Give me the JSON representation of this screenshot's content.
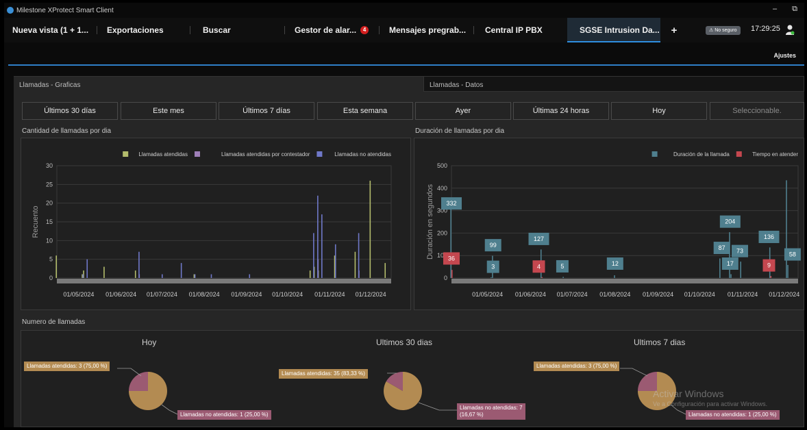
{
  "window": {
    "title": "Milestone XProtect Smart Client",
    "minimize_glyph": "–",
    "restore_glyph": "⧉"
  },
  "tabs": [
    {
      "label": "Nueva vista (1 + 1...",
      "badge": ""
    },
    {
      "label": "Exportaciones",
      "badge": ""
    },
    {
      "label": "Buscar",
      "badge": ""
    },
    {
      "label": "Gestor de alar...",
      "badge": "4"
    },
    {
      "label": "Mensajes pregrab...",
      "badge": ""
    },
    {
      "label": "Central IP PBX",
      "badge": ""
    },
    {
      "label": "SGSE Intrusion Da...",
      "badge": ""
    }
  ],
  "add_tab": "+",
  "status": {
    "security": "⚠ No seguro",
    "time": "17:29:25"
  },
  "settings_label": "Ajustes",
  "subtabs": {
    "graphs": "Llamadas - Graficas",
    "data": "Llamadas - Datos"
  },
  "filters": [
    "Últimos 30 días",
    "Este mes",
    "Últimos 7 días",
    "Esta semana",
    "Ayer",
    "Últimas 24 horas",
    "Hoy",
    "Seleccionable."
  ],
  "sections": {
    "count": "Cantidad de llamadas por dia",
    "duration": "Duración de llamadas por dia",
    "number": "Numero de llamadas"
  },
  "colors": {
    "answered": "#b3bc6c",
    "voicemail": "#9e7fb8",
    "unanswered": "#6f78c8",
    "duration": "#4f7f8e",
    "wait": "#c4474f",
    "pie_answered": "#b38b52",
    "pie_unanswered": "#9b5a72",
    "accent": "#2f8ee0"
  },
  "chart_data": [
    {
      "type": "bar",
      "title": "Cantidad de llamadas por dia",
      "ylabel": "Recuento",
      "ylim": [
        0,
        30
      ],
      "yticks": [
        0,
        5,
        10,
        15,
        20,
        25,
        30
      ],
      "xlim": [
        "2024-04-15",
        "2024-12-16"
      ],
      "xticks": [
        "01/05/2024",
        "01/06/2024",
        "01/07/2024",
        "01/08/2024",
        "01/09/2024",
        "01/10/2024",
        "01/11/2024",
        "01/12/2024"
      ],
      "legend_position": "top-right",
      "grid": true,
      "series": [
        {
          "name": "Llamadas atendidas",
          "points": [
            [
              "2024-04-15",
              6
            ],
            [
              "2024-05-04",
              1
            ],
            [
              "2024-05-05",
              2
            ],
            [
              "2024-05-20",
              3
            ],
            [
              "2024-06-12",
              2
            ],
            [
              "2024-07-25",
              1
            ],
            [
              "2024-10-18",
              2
            ],
            [
              "2024-10-21",
              3
            ],
            [
              "2024-10-24",
              2
            ],
            [
              "2024-11-05",
              6
            ],
            [
              "2024-11-20",
              7
            ],
            [
              "2024-12-01",
              26
            ],
            [
              "2024-12-12",
              4
            ]
          ]
        },
        {
          "name": "Llamadas atendidas por contestador",
          "points": [
            [
              "2024-06-14",
              1
            ],
            [
              "2024-10-23",
              5
            ],
            [
              "2024-11-22",
              2
            ]
          ]
        },
        {
          "name": "Llamadas no atendidas",
          "points": [
            [
              "2024-05-03",
              1
            ],
            [
              "2024-05-06",
              5
            ],
            [
              "2024-06-13",
              7
            ],
            [
              "2024-06-30",
              1
            ],
            [
              "2024-07-14",
              4
            ],
            [
              "2024-07-24",
              1
            ],
            [
              "2024-08-05",
              1
            ],
            [
              "2024-09-02",
              1
            ],
            [
              "2024-10-19",
              12
            ],
            [
              "2024-10-22",
              22
            ],
            [
              "2024-10-25",
              17
            ],
            [
              "2024-11-04",
              9
            ],
            [
              "2024-11-21",
              12
            ]
          ]
        }
      ]
    },
    {
      "type": "bar",
      "title": "Duración de llamadas por dia",
      "ylabel": "Duración en segundos",
      "ylim": [
        0,
        500
      ],
      "yticks": [
        0,
        100,
        200,
        300,
        400,
        500
      ],
      "xlim": [
        "2024-04-05",
        "2024-12-11"
      ],
      "xticks": [
        "01/05/2024",
        "01/06/2024",
        "01/07/2024",
        "01/08/2024",
        "01/09/2024",
        "01/10/2024",
        "01/11/2024",
        "01/12/2024"
      ],
      "legend_position": "top-right",
      "grid": true,
      "series": [
        {
          "name": "Duración de la llamada",
          "points": [
            [
              "2024-04-05",
              332
            ],
            [
              "2024-05-04",
              3
            ],
            [
              "2024-05-05",
              99
            ],
            [
              "2024-06-09",
              127
            ],
            [
              "2024-06-25",
              5
            ],
            [
              "2024-08-01",
              12
            ],
            [
              "2024-10-16",
              87
            ],
            [
              "2024-10-23",
              204
            ],
            [
              "2024-10-24",
              17
            ],
            [
              "2024-10-31",
              73
            ],
            [
              "2024-11-21",
              136
            ],
            [
              "2024-12-04",
              58
            ],
            [
              "2024-12-03",
              435
            ]
          ]
        },
        {
          "name": "Tiempo en atender",
          "points": [
            [
              "2024-04-05",
              36
            ],
            [
              "2024-06-09",
              4
            ],
            [
              "2024-11-21",
              9
            ]
          ]
        }
      ],
      "data_labels": [
        {
          "text": "332",
          "series": 0,
          "x": "2024-04-05",
          "y": 332
        },
        {
          "text": "36",
          "series": 1,
          "x": "2024-04-05",
          "y": 87
        },
        {
          "text": "99",
          "series": 0,
          "x": "2024-05-05",
          "y": 146
        },
        {
          "text": "3",
          "series": 0,
          "x": "2024-05-05",
          "y": 50
        },
        {
          "text": "127",
          "series": 0,
          "x": "2024-06-07",
          "y": 174
        },
        {
          "text": "4",
          "series": 1,
          "x": "2024-06-07",
          "y": 51
        },
        {
          "text": "5",
          "series": 0,
          "x": "2024-06-24",
          "y": 52
        },
        {
          "text": "12",
          "series": 0,
          "x": "2024-08-01",
          "y": 64
        },
        {
          "text": "87",
          "series": 0,
          "x": "2024-10-17",
          "y": 134
        },
        {
          "text": "204",
          "series": 0,
          "x": "2024-10-23",
          "y": 251
        },
        {
          "text": "17",
          "series": 0,
          "x": "2024-10-23",
          "y": 64
        },
        {
          "text": "73",
          "series": 0,
          "x": "2024-10-30",
          "y": 120
        },
        {
          "text": "136",
          "series": 0,
          "x": "2024-11-20",
          "y": 183
        },
        {
          "text": "9",
          "series": 1,
          "x": "2024-11-20",
          "y": 56
        },
        {
          "text": "58",
          "series": 0,
          "x": "2024-12-07",
          "y": 105
        }
      ]
    },
    {
      "type": "pie",
      "title": "Hoy",
      "slices": [
        {
          "label": "Llamadas atendidas: 3 (75,00 %)",
          "value": 75
        },
        {
          "label": "Llamadas no atendidas: 1 (25,00 %)",
          "value": 25
        }
      ]
    },
    {
      "type": "pie",
      "title": "Ultimos 30 dias",
      "slices": [
        {
          "label": "Llamadas atendidas: 35 (83,33 %)",
          "value": 83.33
        },
        {
          "label": "Llamadas no atendidas: 7 (16,67 %)",
          "value": 16.67
        }
      ]
    },
    {
      "type": "pie",
      "title": "Ultimos 7 dias",
      "slices": [
        {
          "label": "Llamadas atendidas: 3 (75,00 %)",
          "value": 75
        },
        {
          "label": "Llamadas no atendidas: 1 (25,00 %)",
          "value": 25
        }
      ]
    }
  ],
  "pie_callouts": {
    "c0": "Llamadas atendidas: 3 (75,00 %)",
    "c1": "Llamadas no atendidas: 1 (25,00 %)",
    "c2": "Llamadas atendidas: 35 (83,33 %)",
    "c3a": "Llamadas no atendidas: 7",
    "c3b": "(16,67 %)",
    "c4": "Llamadas atendidas: 3 (75,00 %)",
    "c5": "Llamadas no atendidas: 1 (25,00 %)"
  },
  "watermark": {
    "line1": "Activar Windows",
    "line2": "Ve a Configuración para activar Windows."
  }
}
